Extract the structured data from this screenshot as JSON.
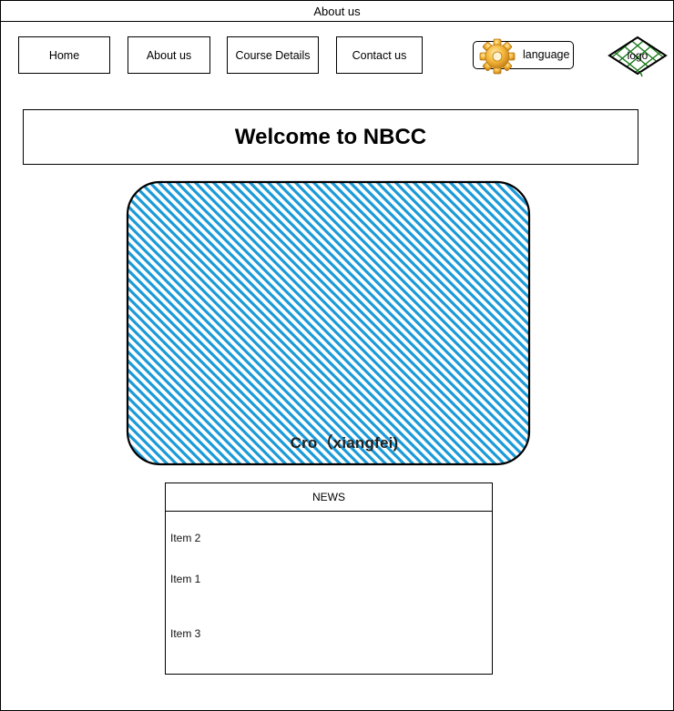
{
  "window": {
    "title": "About us"
  },
  "nav": {
    "items": [
      {
        "label": "Home"
      },
      {
        "label": "About us"
      },
      {
        "label": "Course Details"
      },
      {
        "label": "Contact us"
      }
    ]
  },
  "language_button": {
    "label": "language",
    "icon": "gear-icon"
  },
  "logo": {
    "label": "logo",
    "color": "#1a7a1a"
  },
  "welcome": {
    "heading": "Welcome to NBCC"
  },
  "hero": {
    "caption": "Cro（xiangfei)",
    "fill_color": "#1b9ad8"
  },
  "news": {
    "title": "NEWS",
    "items": [
      "Item 2",
      "Item 1",
      "Item 3"
    ]
  }
}
